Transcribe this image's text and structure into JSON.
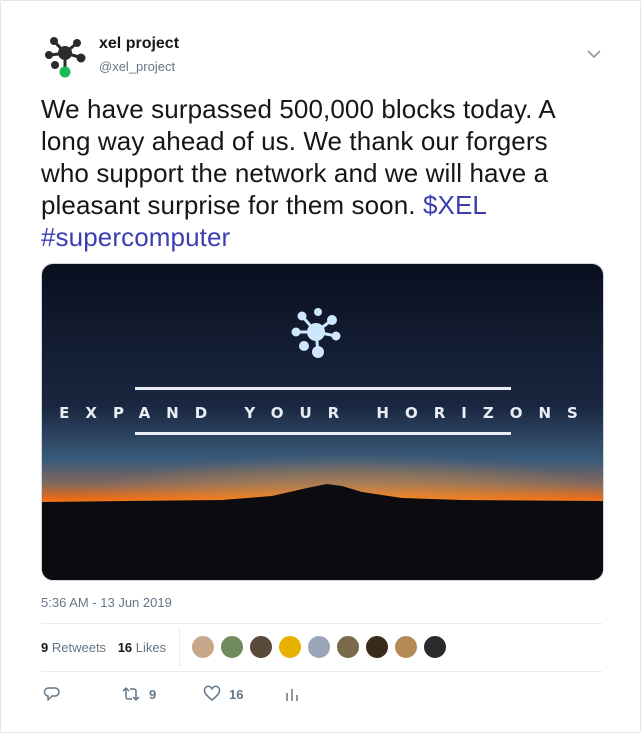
{
  "tweet": {
    "author_name": "xel project",
    "author_handle": "@xel_project",
    "text_plain": "We have surpassed 500,000 blocks today. A long way ahead of us. We thank our forgers who support the network and we will have a pleasant surprise for them soon. ",
    "cashtag": "$XEL",
    "hashtag": "#supercomputer",
    "media_caption": "EXPAND YOUR HORIZONS",
    "timestamp": "5:36 AM - 13 Jun 2019"
  },
  "stats": {
    "retweets_count": "9",
    "retweets_label": "Retweets",
    "likes_count": "16",
    "likes_label": "Likes"
  },
  "likers": [
    {
      "name": "liker-1",
      "color": "#c8a88a"
    },
    {
      "name": "liker-2",
      "color": "#6f8a5c"
    },
    {
      "name": "liker-3",
      "color": "#5a4a3a"
    },
    {
      "name": "liker-4",
      "color": "#e8b100"
    },
    {
      "name": "liker-5",
      "color": "#9aa6b8"
    },
    {
      "name": "liker-6",
      "color": "#7a6a4a"
    },
    {
      "name": "liker-7",
      "color": "#3a2a1a"
    },
    {
      "name": "liker-8",
      "color": "#b58a55"
    },
    {
      "name": "liker-9",
      "color": "#2a2a2a"
    }
  ],
  "actions": {
    "reply_count": "",
    "retweet_count": "9",
    "like_count": "16"
  },
  "icons": {
    "reply": "reply-icon",
    "retweet": "retweet-icon",
    "like": "heart-icon",
    "analytics": "analytics-icon",
    "caret": "chevron-down-icon"
  },
  "colors": {
    "link": "#3b3eb0",
    "secondary_text": "#657786",
    "logo_green": "#1db954"
  }
}
